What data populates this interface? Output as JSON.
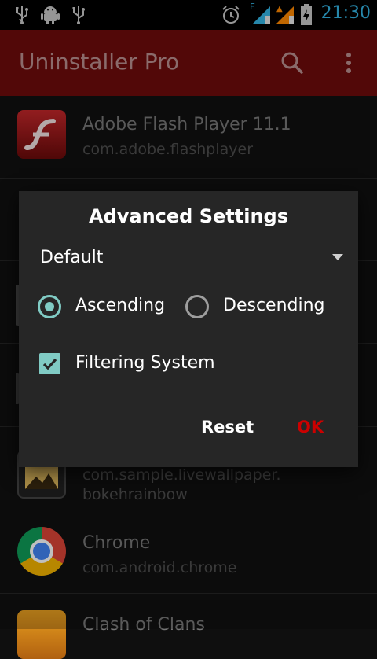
{
  "status_bar": {
    "time": "21:30",
    "icons": [
      "usb-icon",
      "android-debug-icon",
      "usb-icon",
      "alarm-icon",
      "signal-edge-icon",
      "signal-2-icon",
      "battery-charging-icon"
    ]
  },
  "app_bar": {
    "title": "Uninstaller Pro",
    "actions": [
      "search-icon",
      "overflow-menu-icon"
    ]
  },
  "apps": [
    {
      "name": "Adobe Flash Player 11.1",
      "package": "com.adobe.flashplayer"
    },
    {
      "name": "",
      "package": ""
    },
    {
      "name": "",
      "package": ""
    },
    {
      "name": "",
      "package": ""
    },
    {
      "name": "",
      "package": "com.sample.livewallpaper.\nbokehrainbow"
    },
    {
      "name": "Chrome",
      "package": "com.android.chrome"
    },
    {
      "name": "Clash of Clans",
      "package": ""
    }
  ],
  "dialog": {
    "title": "Advanced Settings",
    "sort_spinner": {
      "selected": "Default"
    },
    "order_options": [
      {
        "label": "Ascending",
        "selected": true
      },
      {
        "label": "Descending",
        "selected": false
      }
    ],
    "filter_system": {
      "label": "Filtering System",
      "checked": true
    },
    "reset_label": "Reset",
    "ok_label": "OK"
  },
  "colors": {
    "app_bar": "#6e0b0b",
    "accent_teal": "#80cbc4",
    "ok_red": "#cc0000",
    "status_time": "#33b5e5",
    "dialog_bg": "#262626"
  }
}
